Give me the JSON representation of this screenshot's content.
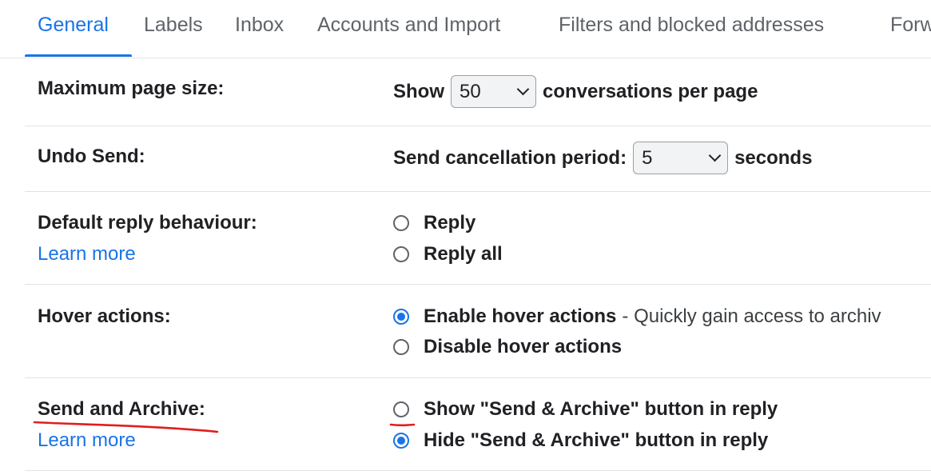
{
  "tabs": [
    {
      "label": "General",
      "active": true
    },
    {
      "label": "Labels"
    },
    {
      "label": "Inbox"
    },
    {
      "label": "Accounts and Import"
    },
    {
      "label": "Filters and blocked addresses"
    },
    {
      "label": "Forw"
    }
  ],
  "page_size": {
    "label": "Maximum page size:",
    "prefix": "Show",
    "value": "50",
    "suffix": "conversations per page"
  },
  "undo_send": {
    "label": "Undo Send:",
    "prefix": "Send cancellation period:",
    "value": "5",
    "suffix": "seconds"
  },
  "reply_behaviour": {
    "label": "Default reply behaviour:",
    "learn_more": "Learn more",
    "options": [
      {
        "label": "Reply",
        "checked": false
      },
      {
        "label": "Reply all",
        "checked": false
      }
    ]
  },
  "hover_actions": {
    "label": "Hover actions:",
    "options": [
      {
        "label": "Enable hover actions",
        "desc": "- Quickly gain access to archiv",
        "checked": true
      },
      {
        "label": "Disable hover actions",
        "checked": false
      }
    ]
  },
  "send_archive": {
    "label": "Send and Archive:",
    "learn_more": "Learn more",
    "options": [
      {
        "label": "Show \"Send & Archive\" button in reply",
        "checked": false
      },
      {
        "label": "Hide \"Send & Archive\" button in reply",
        "checked": true
      }
    ]
  },
  "colors": {
    "accent": "#1a73e8",
    "annotation": "#e01e1e",
    "text": "#202124"
  }
}
